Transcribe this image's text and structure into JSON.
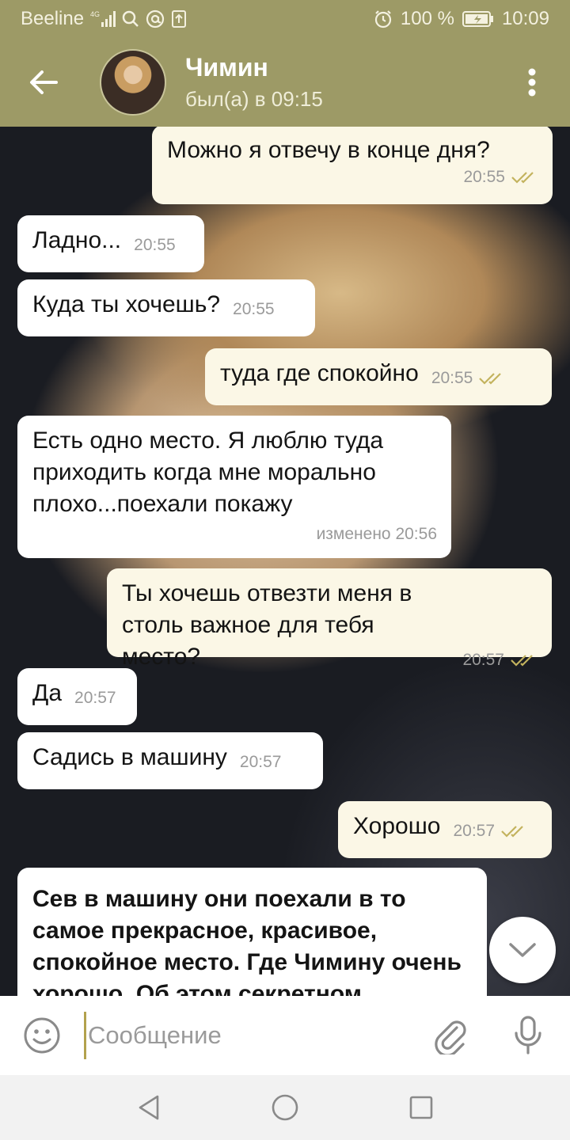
{
  "status_bar": {
    "carrier": "Beeline",
    "network": "4G",
    "battery": "100 %",
    "time": "10:09"
  },
  "header": {
    "contact_name": "Чимин",
    "contact_status": "был(а) в 09:15"
  },
  "messages": [
    {
      "text": "Можно я отвечу в конце дня?",
      "time": "20:55"
    },
    {
      "text": "Ладно...",
      "time": "20:55"
    },
    {
      "text": "Куда ты хочешь?",
      "time": "20:55"
    },
    {
      "text": "туда где спокойно",
      "time": "20:55"
    },
    {
      "text": "Есть одно место. Я люблю туда приходить когда мне морально плохо...поехали покажу",
      "time": "изменено 20:56"
    },
    {
      "text": "Ты хочешь отвезти меня в столь важное для тебя место?",
      "time": "20:57"
    },
    {
      "text": "Да",
      "time": "20:57"
    },
    {
      "text": "Садись в машину",
      "time": "20:57"
    },
    {
      "text": "Хорошо",
      "time": "20:57"
    },
    {
      "text": "Сев в машину они поехали в то самое прекрасное, красивое, спокойное место. Где Чимину очень хорошо. Об этом секретном"
    }
  ],
  "input": {
    "placeholder": "Сообщение"
  },
  "colors": {
    "header_bg": "#9d9a66",
    "incoming_bubble": "#ffffff",
    "outgoing_bubble": "#fbf7e6",
    "read_check": "#c3b35e"
  }
}
